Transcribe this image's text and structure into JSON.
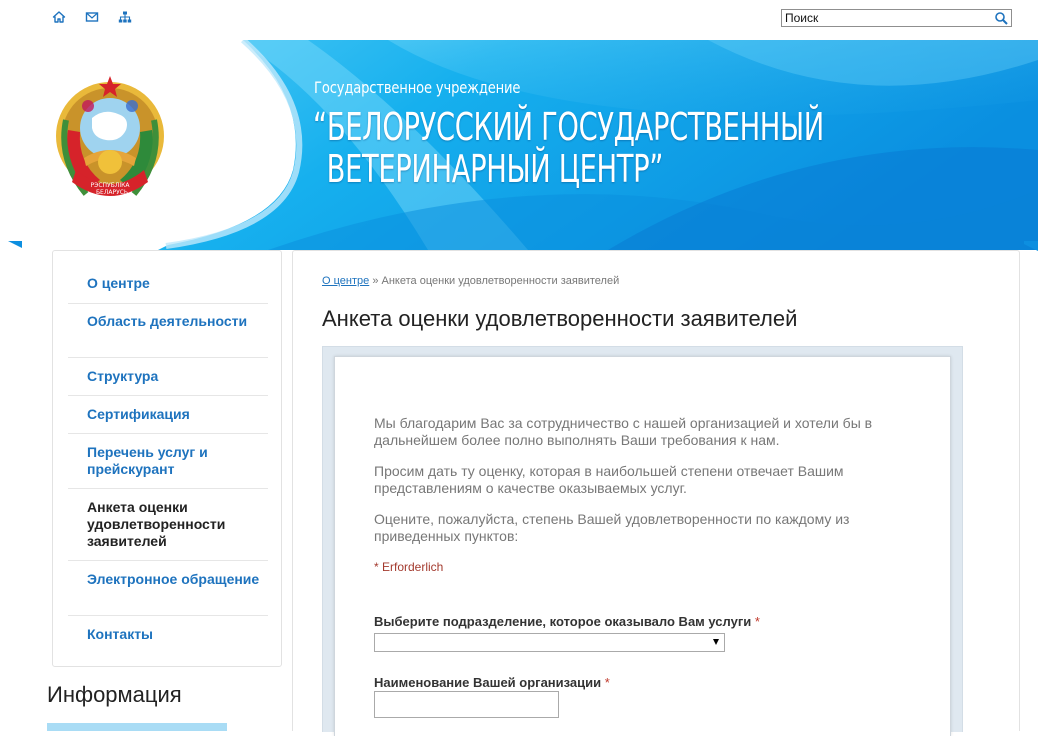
{
  "topbar": {
    "icons": [
      "home-icon",
      "mail-icon",
      "sitemap-icon"
    ],
    "search": {
      "placeholder": "Поиск"
    }
  },
  "header": {
    "subtitle": "Государственное учреждение",
    "title_line1": "“БЕЛОРУССКИЙ ГОСУДАРСТВЕННЫЙ",
    "title_line2": "ВЕТЕРИНАРНЫЙ ЦЕНТР”",
    "emblem_text": "РЭСПУБЛІКА БЕЛАРУСЬ",
    "colors": {
      "banner": "#0d9fe8",
      "banner_light": "#4cc3f5",
      "accent": "#1e73be"
    }
  },
  "sidebar": {
    "items": [
      {
        "label": "О центре"
      },
      {
        "label": "Область деятельности"
      },
      {
        "label": "Структура"
      },
      {
        "label": "Сертификация"
      },
      {
        "label": "Перечень услуг и прейскурант"
      },
      {
        "label": "Анкета оценки удовлетворенности заявителей",
        "active": true
      },
      {
        "label": "Электронное обращение"
      },
      {
        "label": "Контакты"
      }
    ],
    "info_title": "Информация"
  },
  "main": {
    "breadcrumb": {
      "home": "О центре",
      "separator": "»",
      "current": "Анкета оценки удовлетворенности заявителей"
    },
    "title": "Анкета оценки удовлетворенности заявителей",
    "form": {
      "intro1": "Мы благодарим Вас за сотрудничество с нашей организацией и хотели бы в дальнейшем более полно выполнять Ваши требования к нам.",
      "intro2": "Просим дать ту оценку, которая в наибольшей степени отвечает Вашим представлениям о качестве оказываемых услуг.",
      "intro3": "Оцените, пожалуйста, степень Вашей удовлетворенности по каждому из приведенных пунктов:",
      "required_note": "* Erforderlich",
      "fields": [
        {
          "label": "Выберите подразделение, которое оказывало Вам услуги",
          "required_mark": "*",
          "type": "select",
          "value": ""
        },
        {
          "label": "Наименование Вашей организации",
          "required_mark": "*",
          "type": "text",
          "value": ""
        }
      ]
    }
  }
}
